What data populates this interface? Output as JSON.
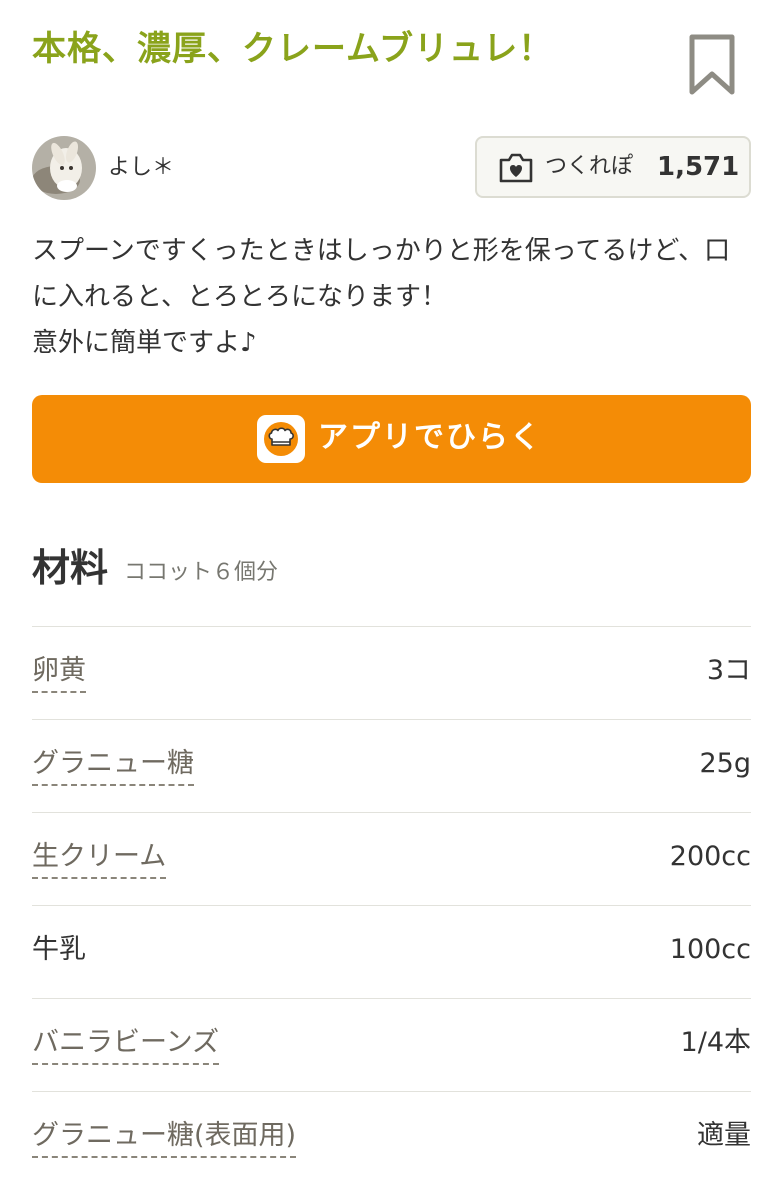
{
  "recipe": {
    "title": "本格、濃厚、クレームブリュレ！",
    "bookmark_icon": "bookmark-icon",
    "author": {
      "name": "よし＊",
      "avatar_icon": "avatar-photo"
    },
    "tsukurepo": {
      "icon": "camera-heart-icon",
      "label": "つくれぽ",
      "count": "1,571"
    },
    "description": "スプーンですくったときはしっかりと形を保ってるけど、口に入れると、とろとろになります！\n意外に簡単ですよ♪",
    "app_button": {
      "icon": "cookpad-chef-hat-icon",
      "label": "アプリでひらく"
    }
  },
  "ingredients": {
    "title": "材料",
    "servings": "ココット６個分",
    "items": [
      {
        "name": "卵黄",
        "amount": "3コ",
        "linked": true
      },
      {
        "name": "グラニュー糖",
        "amount": "25g",
        "linked": true
      },
      {
        "name": "生クリーム",
        "amount": "200cc",
        "linked": true
      },
      {
        "name": "牛乳",
        "amount": "100cc",
        "linked": false
      },
      {
        "name": "バニラビーンズ",
        "amount": "1/4本",
        "linked": true
      },
      {
        "name": "グラニュー糖(表面用)",
        "amount": "適量",
        "linked": true
      }
    ]
  },
  "colors": {
    "title_green": "#8aa31b",
    "accent_orange": "#f48c06",
    "text": "#333333",
    "muted": "#777770"
  }
}
